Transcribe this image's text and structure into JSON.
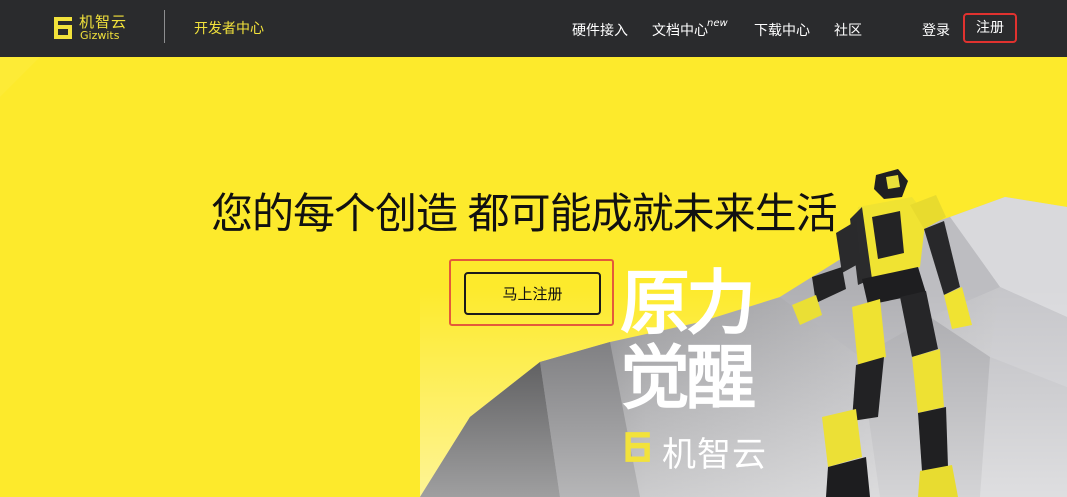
{
  "header": {
    "logo_cn": "机智云",
    "logo_en": "Gizwits",
    "dev_center": "开发者中心",
    "nav": [
      {
        "label": "硬件接入"
      },
      {
        "label": "文档中心",
        "badge": "new"
      },
      {
        "label": "下载中心"
      },
      {
        "label": "社区"
      }
    ],
    "login": "登录",
    "register": "注册"
  },
  "hero": {
    "headline": "您的每个创造 都可能成就未来生活",
    "cta": "马上注册",
    "poster_line1": "原力",
    "poster_line2": "觉醒",
    "poster_brand": "机智云"
  },
  "colors": {
    "header_bg": "#2a2b2d",
    "hero_bg": "#fdea2c",
    "brand_yellow": "#f2e23b",
    "highlight_red": "#e0322f"
  },
  "icons": [
    "gizwits-logo-icon",
    "robot-illustration",
    "rock-terrain-illustration"
  ]
}
